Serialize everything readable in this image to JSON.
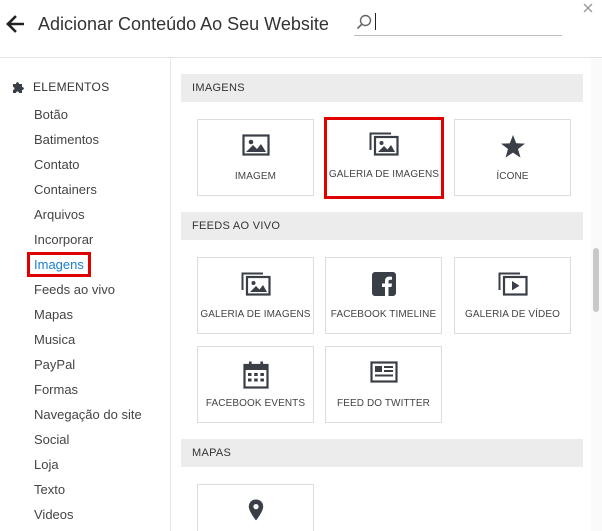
{
  "header": {
    "title": "Adicionar Conteúdo Ao Seu Website",
    "search_placeholder": "",
    "search_value": ""
  },
  "sidebar": {
    "heading": "ELEMENTOS",
    "items": [
      {
        "label": "Botão"
      },
      {
        "label": "Batimentos"
      },
      {
        "label": "Contato"
      },
      {
        "label": "Containers"
      },
      {
        "label": "Arquivos"
      },
      {
        "label": "Incorporar"
      },
      {
        "label": "Imagens",
        "active": true
      },
      {
        "label": "Feeds ao vivo"
      },
      {
        "label": "Mapas"
      },
      {
        "label": "Musica"
      },
      {
        "label": "PayPal"
      },
      {
        "label": "Formas"
      },
      {
        "label": "Navegação do site"
      },
      {
        "label": "Social"
      },
      {
        "label": "Loja"
      },
      {
        "label": "Texto"
      },
      {
        "label": "Videos"
      }
    ]
  },
  "sections": {
    "imagens": {
      "title": "IMAGENS",
      "cards": [
        {
          "label": "IMAGEM",
          "icon": "image-icon"
        },
        {
          "label": "GALERIA DE IMAGENS",
          "icon": "gallery-icon",
          "highlighted": true
        },
        {
          "label": "ÍCONE",
          "icon": "star-icon"
        }
      ]
    },
    "feeds": {
      "title": "FEEDS AO VIVO",
      "cards": [
        {
          "label": "GALERIA DE IMAGENS",
          "icon": "gallery-icon"
        },
        {
          "label": "FACEBOOK TIMELINE",
          "icon": "facebook-icon"
        },
        {
          "label": "GALERIA DE VÍDEO",
          "icon": "video-gallery-icon"
        },
        {
          "label": "FACEBOOK EVENTS",
          "icon": "calendar-icon"
        },
        {
          "label": "FEED DO TWITTER",
          "icon": "twitter-feed-icon"
        }
      ]
    },
    "mapas": {
      "title": "MAPAS",
      "cards": [
        {
          "label": "",
          "icon": "map-pin-icon"
        }
      ]
    }
  },
  "colors": {
    "highlight": "#e00000",
    "active_link": "#1a7fd4",
    "icon": "#3a3f47",
    "section_bg": "#ececec"
  }
}
